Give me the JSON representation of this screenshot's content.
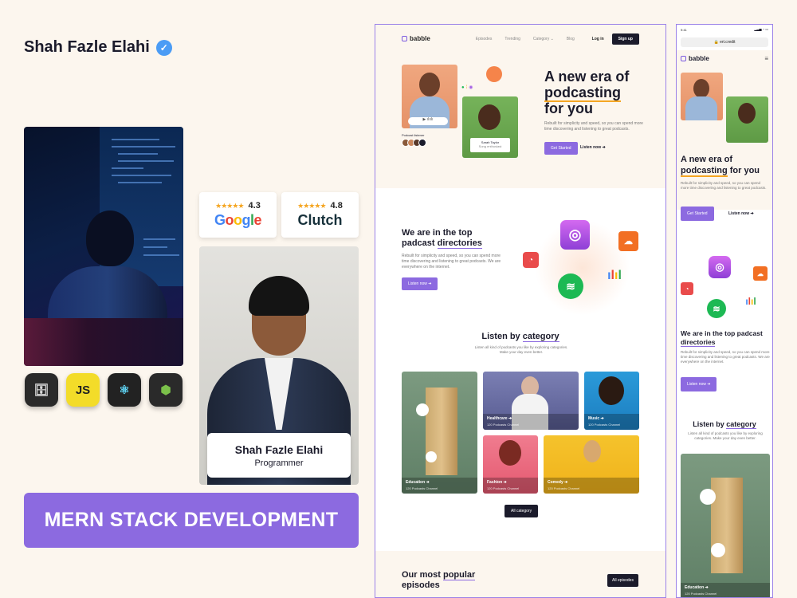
{
  "author": {
    "name": "Shah Fazle Elahi"
  },
  "tech_stack": [
    "MongoDB",
    "JS",
    "React",
    "Node.js"
  ],
  "ratings": [
    {
      "stars": "★★★★★",
      "score": "4.3",
      "brand": "Google"
    },
    {
      "stars": "★★★★★",
      "score": "4.8",
      "brand": "Clutch"
    }
  ],
  "profile": {
    "name": "Shah Fazle Elahi",
    "role": "Programmer"
  },
  "banner": "MERN STACK DEVELOPMENT",
  "colors": {
    "accent": "#8c6ae0",
    "background": "#fcf6ee",
    "dark": "#1b1b2b",
    "underline": "#f5a623"
  },
  "desktop": {
    "logo": "babble",
    "nav": [
      "Episodes",
      "Trending",
      "Category ⌄",
      "Blog"
    ],
    "login": "Log in",
    "signup": "Sign up",
    "hero": {
      "title_1": "A new era of",
      "title_2": "podcasting",
      "title_3": "for you",
      "subtitle": "Rebuilt for simplicity and speed, so you can spend more time discovering and listening to great podcasts.",
      "cta": "Get Started",
      "listen": "Listen now ➔",
      "listener_label": "Podcast listener",
      "singer_name": "Sarah Taylor",
      "singer_role": "Song enthusiast"
    },
    "directories": {
      "title_1": "We are in the top",
      "title_2": "padcast",
      "title_3": "directories",
      "subtitle": "Rebuilt for simplicity and speed, so you can spend more time discovering and listening to great podcasts. We are everywhere on the internet.",
      "cta": "Listen now ➔"
    },
    "category": {
      "title_1": "Listen by",
      "title_2": "category",
      "subtitle": "Listen all kind of podcasts you like by exploring categories. Make your day even better.",
      "tiles": [
        {
          "name": "Education ➔",
          "count": "120 Podcasts Channel"
        },
        {
          "name": "Healthcare ➔",
          "count": "120 Podcasts Channel"
        },
        {
          "name": "Music ➔",
          "count": "120 Podcasts Channel"
        },
        {
          "name": "Fashion ➔",
          "count": "120 Podcasts Channel"
        },
        {
          "name": "Comedy ➔",
          "count": "120 Podcasts Channel"
        }
      ],
      "all": "All category"
    },
    "episodes": {
      "title_1": "Our most",
      "title_2": "popular",
      "title_3": "episodes",
      "cta": "All episodes"
    }
  },
  "mobile": {
    "time": "9:41",
    "url": "🔒 ert.credit",
    "logo": "babble",
    "hero": {
      "title_1": "A new era of",
      "title_2": "podcasting",
      "title_3": "for you",
      "subtitle": "Rebuilt for simplicity and speed, so you can spend more time discovering and listening to great podcasts.",
      "cta": "Get Started",
      "listen": "Listen now ➔"
    },
    "directories": {
      "title_1": "We are in the top padcast",
      "title_2": "directories",
      "subtitle": "Rebuilt for simplicity and speed, so you can spend more time discovering and listening to great podcasts. We are everywhere on the internet.",
      "cta": "Listen now ➔"
    },
    "category": {
      "title_1": "Listen by",
      "title_2": "category",
      "subtitle": "Listen all kind of podcasts you like by exploring categories. Make your day even better.",
      "tile_name": "Education ➔",
      "tile_count": "120 Podcasts Channel"
    }
  }
}
